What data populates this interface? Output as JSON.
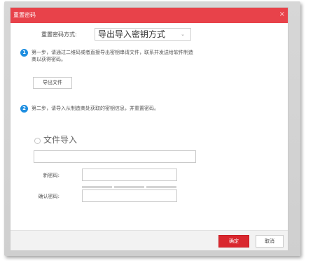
{
  "dialog": {
    "title": "重置密码",
    "close_glyph": "×",
    "accent_color": "#e8424a"
  },
  "method": {
    "label": "重置密码方式:",
    "selected": "导出导入密钥方式",
    "caret_glyph": "⌄"
  },
  "step1": {
    "number": "1",
    "line1": "第一步，请通过二维码或者直接导出密钥串请文件，联系并发送给软件制造",
    "line2": "商以获得密码。",
    "export_button": "导出文件"
  },
  "step2": {
    "number": "2",
    "text": "第二步，请导入从制造商处获取的密钥信息，并重置密码。"
  },
  "file_import": {
    "radio_label": "文件导入",
    "value": ""
  },
  "new_password": {
    "label": "新密码:",
    "value": ""
  },
  "confirm_password": {
    "label": "确认密码:",
    "value": ""
  },
  "footer": {
    "ok_label": "确定",
    "cancel_label": "取消",
    "ok_color": "#d9272e"
  }
}
